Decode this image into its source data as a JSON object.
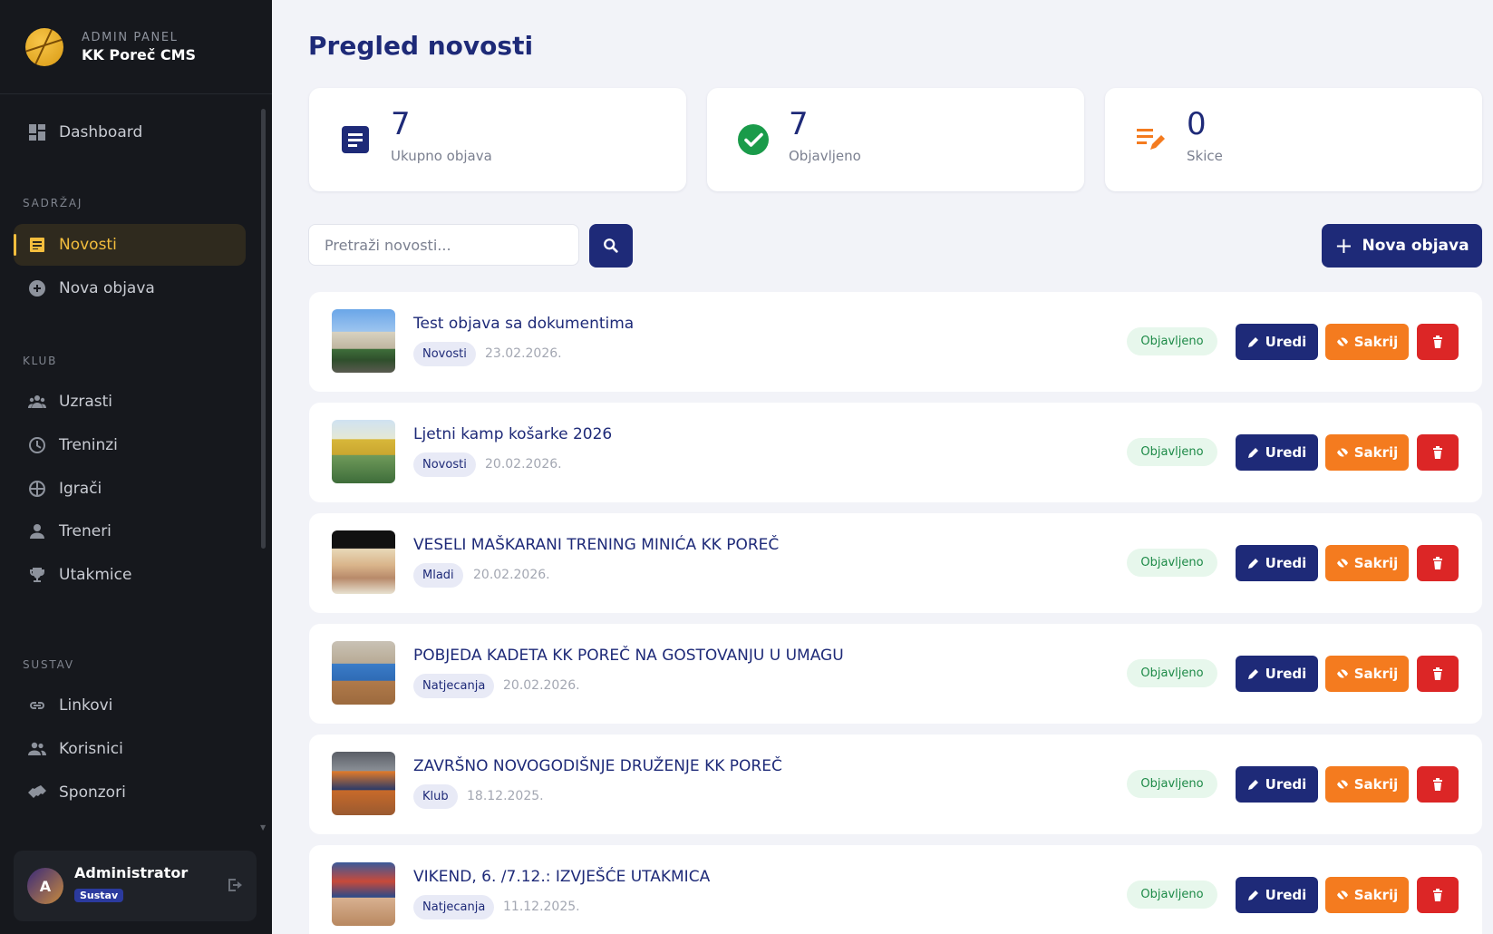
{
  "sidebar": {
    "brand_small": "ADMIN PANEL",
    "brand_title": "KK Poreč CMS",
    "dashboard": "Dashboard",
    "sections": {
      "sadrzaj": "SADRŽAJ",
      "klub": "KLUB",
      "sustav": "SUSTAV"
    },
    "items": {
      "novosti": "Novosti",
      "nova_objava": "Nova objava",
      "uzrasti": "Uzrasti",
      "treninzi": "Treninzi",
      "igraci": "Igrači",
      "treneri": "Treneri",
      "utakmice": "Utakmice",
      "linkovi": "Linkovi",
      "korisnici": "Korisnici",
      "sponzori": "Sponzori"
    },
    "user": {
      "initial": "A",
      "name": "Administrator",
      "role": "Sustav"
    }
  },
  "main": {
    "title": "Pregled novosti",
    "stats": [
      {
        "value": "7",
        "label": "Ukupno objava"
      },
      {
        "value": "7",
        "label": "Objavljeno"
      },
      {
        "value": "0",
        "label": "Skice"
      }
    ],
    "search_placeholder": "Pretraži novosti...",
    "new_button": "Nova objava",
    "actions": {
      "edit": "Uredi",
      "hide": "Sakrij"
    },
    "posts": [
      {
        "title": "Test objava sa dokumentima",
        "category": "Novosti",
        "date": "23.02.2026.",
        "status": "Objavljeno"
      },
      {
        "title": "Ljetni kamp košarke 2026",
        "category": "Novosti",
        "date": "20.02.2026.",
        "status": "Objavljeno"
      },
      {
        "title": "VESELI MAŠKARANI TRENING MINIĆA KK POREČ",
        "category": "Mladi",
        "date": "20.02.2026.",
        "status": "Objavljeno"
      },
      {
        "title": "POBJEDA KADETA KK POREČ NA GOSTOVANJU U UMAGU",
        "category": "Natjecanja",
        "date": "20.02.2026.",
        "status": "Objavljeno"
      },
      {
        "title": "ZAVRŠNO NOVOGODIŠNJE DRUŽENJE KK POREČ",
        "category": "Klub",
        "date": "18.12.2025.",
        "status": "Objavljeno"
      },
      {
        "title": "VIKEND, 6. /7.12.: IZVJEŠĆE UTAKMICA",
        "category": "Natjecanja",
        "date": "11.12.2025.",
        "status": "Objavljeno"
      }
    ]
  },
  "colors": {
    "primary": "#1e2a78",
    "accent": "#f4be3d",
    "hide": "#f47b1f",
    "delete": "#dc2626",
    "success": "#1d8a47"
  }
}
